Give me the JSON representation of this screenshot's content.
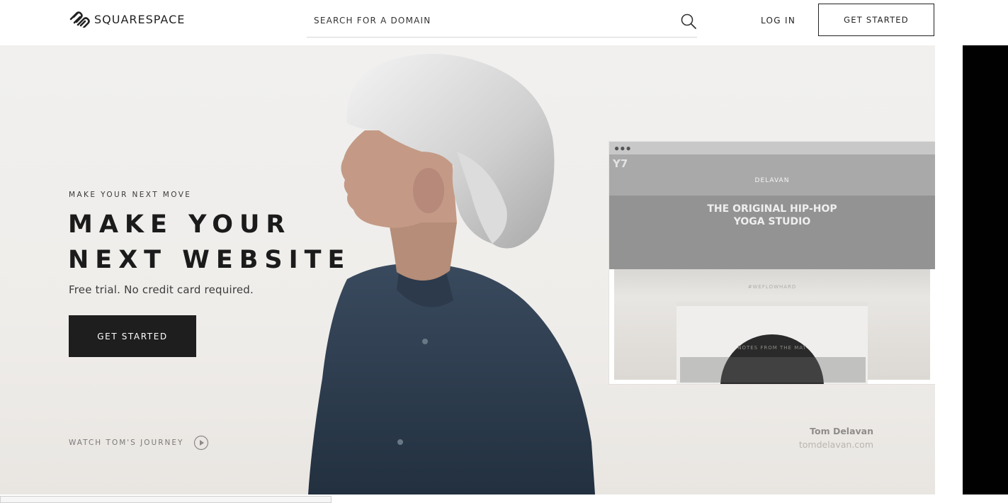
{
  "header": {
    "logo_text": "SQUARESPACE",
    "search_placeholder": "SEARCH FOR A DOMAIN",
    "login_label": "LOG IN",
    "cta_label": "GET STARTED"
  },
  "hero": {
    "eyebrow": "MAKE YOUR NEXT MOVE",
    "headline_line1": "MAKE YOUR",
    "headline_line2": "NEXT WEBSITE",
    "subline": "Free trial. No credit card required.",
    "cta_label": "GET STARTED",
    "watch_label": "WATCH TOM'S JOURNEY"
  },
  "preview": {
    "logo": "Y7",
    "brand": "DELAVAN",
    "title_line1": "THE ORIGINAL HIP-HOP",
    "title_line2": "YOGA STUDIO",
    "tagline": "#WEFLOWHARD",
    "section": "NOTES FROM THE MAT"
  },
  "credit": {
    "name": "Tom Delavan",
    "url": "tomdelavan.com"
  },
  "colors": {
    "hero_bg": "#f0eeeb",
    "dark_button": "#1e1e1e",
    "side_strip": "#020101"
  }
}
